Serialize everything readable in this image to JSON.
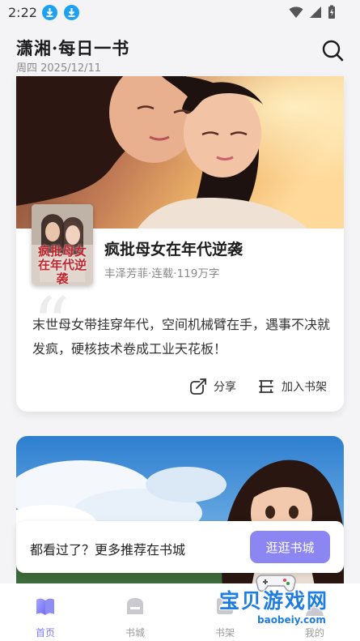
{
  "status_bar": {
    "time": "2:22"
  },
  "header": {
    "title": "潇湘·每日一书",
    "date": "周四 2025/12/11"
  },
  "book": {
    "title": "疯批母女在年代逆袭",
    "meta": "丰泽芳菲·连载·119万字",
    "description": "末世母女带挂穿年代，空间机械臂在手，遇事不决就发疯，硬核技术卷成工业天花板！",
    "cover_text": "疯批母女在年代逆袭"
  },
  "actions": {
    "share": "分享",
    "add_to_shelf": "加入书架"
  },
  "recommend": {
    "text": "都看过了？更多推荐在书城",
    "button": "逛逛书城"
  },
  "nav": {
    "items": [
      {
        "label": "首页",
        "icon": "home-book-icon",
        "active": true
      },
      {
        "label": "书城",
        "icon": "store-icon",
        "active": false
      },
      {
        "label": "书架",
        "icon": "shelf-icon",
        "active": false
      },
      {
        "label": "我的",
        "icon": "profile-icon",
        "active": false
      }
    ]
  },
  "watermark": {
    "text": "宝贝游戏网",
    "url": "baobeiy.com"
  },
  "colors": {
    "accent": "#8b86f2",
    "nav_active": "#7e7ef0",
    "download_badge": "#1da1f2"
  }
}
